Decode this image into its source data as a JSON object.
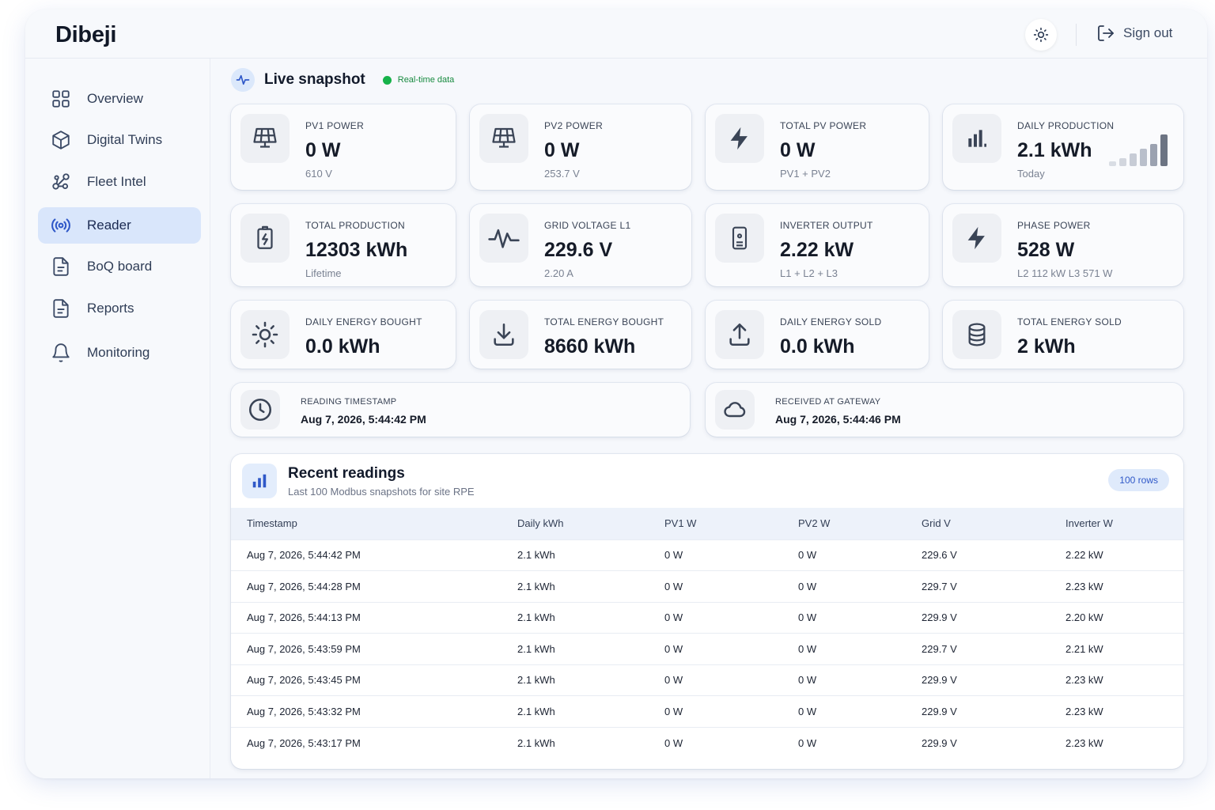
{
  "app": {
    "brand": "Dibeji"
  },
  "topbar": {
    "signout_label": "Sign out"
  },
  "sidebar": {
    "items": [
      {
        "label": "Overview",
        "icon": "grid-icon",
        "active": false
      },
      {
        "label": "Digital Twins",
        "icon": "cube-icon",
        "active": false
      },
      {
        "label": "Fleet Intel",
        "icon": "network-icon",
        "active": false
      },
      {
        "label": "Reader",
        "icon": "broadcast-icon",
        "active": true
      },
      {
        "label": "BoQ board",
        "icon": "document-icon",
        "active": false
      },
      {
        "label": "Reports",
        "icon": "document-icon",
        "active": false
      },
      {
        "label": "Monitoring",
        "icon": "bell-icon",
        "active": false
      }
    ]
  },
  "snapshot": {
    "title": "Live snapshot",
    "status": "Real-time data",
    "cards": [
      {
        "label": "PV1 POWER",
        "value": "0 W",
        "sub": "610 V",
        "icon": "solar-panel-icon"
      },
      {
        "label": "PV2 POWER",
        "value": "0 W",
        "sub": "253.7 V",
        "icon": "solar-panel-icon"
      },
      {
        "label": "TOTAL PV POWER",
        "value": "0 W",
        "sub": "PV1 + PV2",
        "icon": "lightning-icon"
      },
      {
        "label": "DAILY PRODUCTION",
        "value": "2.1 kWh",
        "sub": "Today",
        "icon": "bar-chart-icon"
      },
      {
        "label": "TOTAL PRODUCTION",
        "value": "12303 kWh",
        "sub": "Lifetime",
        "icon": "battery-icon"
      },
      {
        "label": "GRID VOLTAGE L1",
        "value": "229.6 V",
        "sub": "2.20 A",
        "icon": "waveform-icon"
      },
      {
        "label": "INVERTER OUTPUT",
        "value": "2.22 kW",
        "sub": "L1 + L2 + L3",
        "icon": "inverter-icon"
      },
      {
        "label": "PHASE POWER",
        "value": "528 W",
        "sub": "L2 112 kW  L3 571 W",
        "icon": "lightning-icon"
      },
      {
        "label": "DAILY ENERGY BOUGHT",
        "value": "0.0 kWh",
        "sub": "",
        "icon": "sun-icon"
      },
      {
        "label": "TOTAL ENERGY BOUGHT",
        "value": "8660 kWh",
        "sub": "",
        "icon": "download-icon"
      },
      {
        "label": "DAILY ENERGY SOLD",
        "value": "0.0 kWh",
        "sub": "",
        "icon": "upload-icon"
      },
      {
        "label": "TOTAL ENERGY SOLD",
        "value": "2 kWh",
        "sub": "",
        "icon": "database-icon"
      }
    ],
    "timestamps": [
      {
        "label": "READING TIMESTAMP",
        "value": "Aug 7, 2026, 5:44:42 PM",
        "icon": "clock-icon"
      },
      {
        "label": "RECEIVED AT GATEWAY",
        "value": "Aug 7, 2026, 5:44:46 PM",
        "icon": "cloud-icon"
      }
    ]
  },
  "readings": {
    "title": "Recent readings",
    "subtitle": "Last 100 Modbus snapshots for site RPE",
    "badge": "100 rows",
    "columns": [
      "Timestamp",
      "Daily kWh",
      "PV1 W",
      "PV2 W",
      "Grid V",
      "Inverter W"
    ],
    "rows": [
      [
        "Aug 7, 2026, 5:44:42 PM",
        "2.1 kWh",
        "0 W",
        "0 W",
        "229.6 V",
        "2.22 kW"
      ],
      [
        "Aug 7, 2026, 5:44:28 PM",
        "2.1 kWh",
        "0 W",
        "0 W",
        "229.7 V",
        "2.23 kW"
      ],
      [
        "Aug 7, 2026, 5:44:13 PM",
        "2.1 kWh",
        "0 W",
        "0 W",
        "229.9 V",
        "2.20 kW"
      ],
      [
        "Aug 7, 2026, 5:43:59 PM",
        "2.1 kWh",
        "0 W",
        "0 W",
        "229.7 V",
        "2.21 kW"
      ],
      [
        "Aug 7, 2026, 5:43:45 PM",
        "2.1 kWh",
        "0 W",
        "0 W",
        "229.9 V",
        "2.23 kW"
      ],
      [
        "Aug 7, 2026, 5:43:32 PM",
        "2.1 kWh",
        "0 W",
        "0 W",
        "229.9 V",
        "2.23 kW"
      ],
      [
        "Aug 7, 2026, 5:43:17 PM",
        "2.1 kWh",
        "0 W",
        "0 W",
        "229.9 V",
        "2.23 kW"
      ]
    ]
  },
  "colors": {
    "accent": "#2f58c8",
    "active_nav_bg": "#d9e6fb",
    "live_dot": "#16b24a"
  }
}
